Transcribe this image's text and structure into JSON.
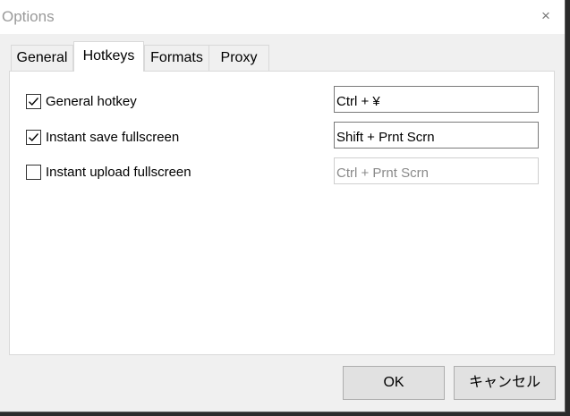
{
  "window": {
    "title": "Options",
    "close_glyph": "×"
  },
  "tabs": [
    {
      "label": "General",
      "active": false
    },
    {
      "label": "Hotkeys",
      "active": true
    },
    {
      "label": "Formats",
      "active": false
    },
    {
      "label": "Proxy",
      "active": false
    }
  ],
  "hotkeys": [
    {
      "label": "General hotkey",
      "checked": true,
      "value": "Ctrl + ¥",
      "enabled": true
    },
    {
      "label": "Instant save fullscreen",
      "checked": true,
      "value": "Shift + Prnt Scrn",
      "enabled": true
    },
    {
      "label": "Instant upload fullscreen",
      "checked": false,
      "value": "Ctrl + Prnt Scrn",
      "enabled": false
    }
  ],
  "buttons": {
    "ok_label": "OK",
    "cancel_label": "キャンセル"
  },
  "colors": {
    "title_text": "#9a9a9a",
    "window_bg": "#f0f0f0",
    "panel_bg": "#ffffff",
    "button_bg": "#e1e1e1"
  }
}
